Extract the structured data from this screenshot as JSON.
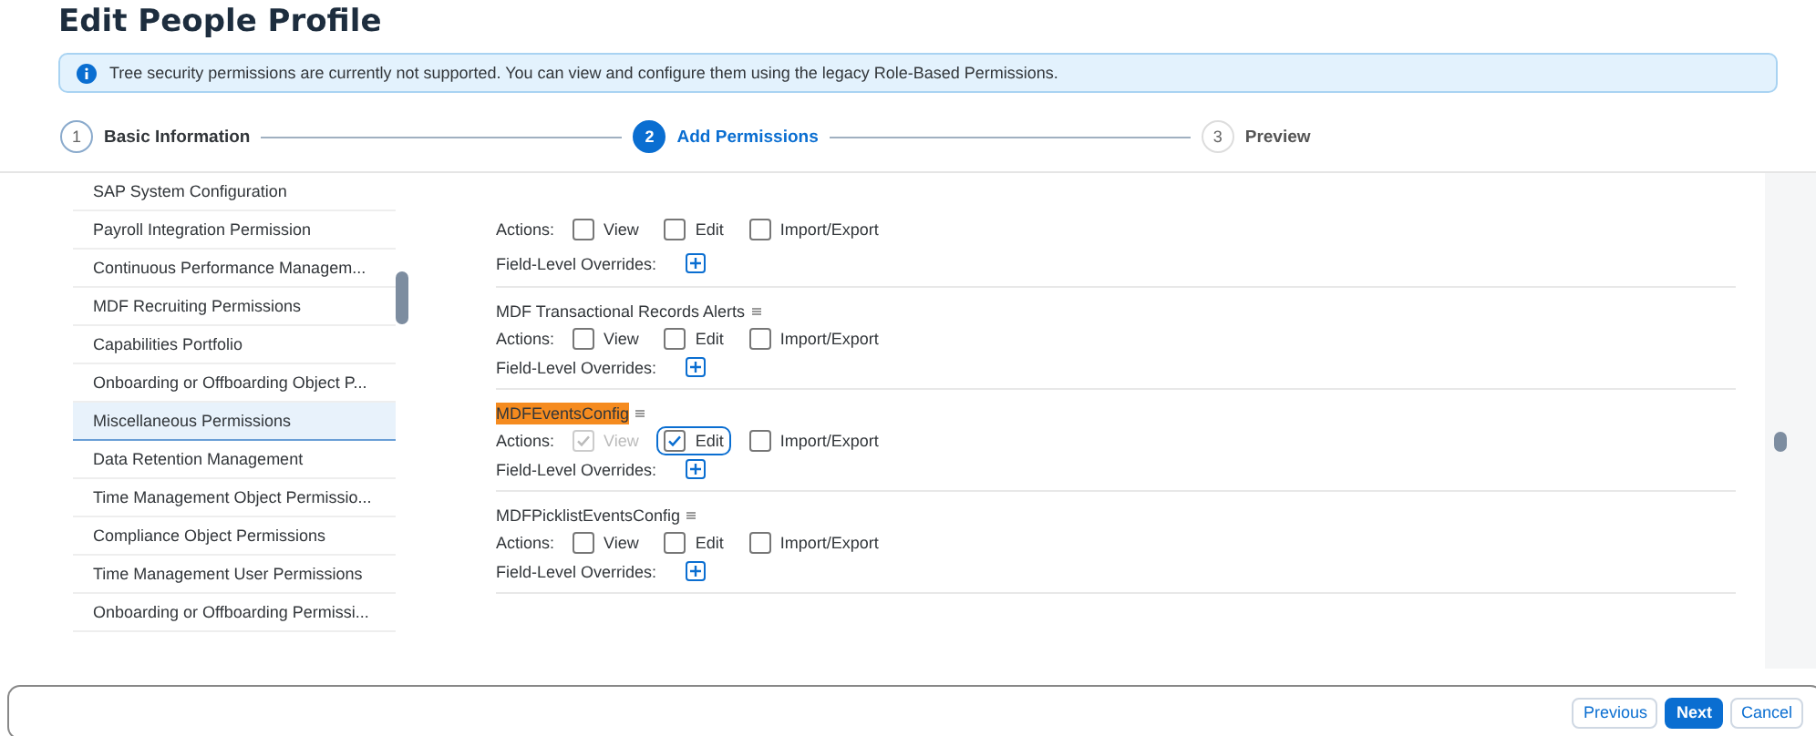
{
  "page": {
    "title": "Edit People Profile"
  },
  "info_strip": {
    "text": "Tree security permissions are currently not supported. You can view and configure them using the legacy Role-Based Permissions."
  },
  "steps": [
    {
      "number": "1",
      "label": "Basic Information",
      "selected": false,
      "completed": true
    },
    {
      "number": "2",
      "label": "Add Permissions",
      "selected": true,
      "completed": false
    },
    {
      "number": "3",
      "label": "Preview",
      "selected": false,
      "completed": false
    }
  ],
  "sidebar": {
    "items": [
      {
        "label": "SAP System Configuration",
        "selected": false
      },
      {
        "label": "Payroll Integration Permission",
        "selected": false
      },
      {
        "label": "Continuous Performance Managem...",
        "selected": false
      },
      {
        "label": "MDF Recruiting Permissions",
        "selected": false
      },
      {
        "label": "Capabilities Portfolio",
        "selected": false
      },
      {
        "label": "Onboarding or Offboarding Object P...",
        "selected": false
      },
      {
        "label": "Miscellaneous Permissions",
        "selected": true
      },
      {
        "label": "Data Retention Management",
        "selected": false
      },
      {
        "label": "Time Management Object Permissio...",
        "selected": false
      },
      {
        "label": "Compliance Object Permissions",
        "selected": false
      },
      {
        "label": "Time Management User Permissions",
        "selected": false
      },
      {
        "label": "Onboarding or Offboarding Permissi...",
        "selected": false
      }
    ]
  },
  "permissions": [
    {
      "actions_label": "Actions:",
      "overrides_label": "Field-Level Overrides:",
      "actions": [
        {
          "label": "View",
          "checked": false,
          "disabled": false,
          "focused": false
        },
        {
          "label": "Edit",
          "checked": false,
          "disabled": false,
          "focused": false
        },
        {
          "label": "Import/Export",
          "checked": false,
          "disabled": false,
          "focused": false
        }
      ]
    },
    {
      "name": "MDF Transactional Records Alerts",
      "highlighted": false,
      "actions_label": "Actions:",
      "overrides_label": "Field-Level Overrides:",
      "actions": [
        {
          "label": "View",
          "checked": false,
          "disabled": false,
          "focused": false
        },
        {
          "label": "Edit",
          "checked": false,
          "disabled": false,
          "focused": false
        },
        {
          "label": "Import/Export",
          "checked": false,
          "disabled": false,
          "focused": false
        }
      ]
    },
    {
      "name": "MDFEventsConfig",
      "highlighted": true,
      "actions_label": "Actions:",
      "overrides_label": "Field-Level Overrides:",
      "actions": [
        {
          "label": "View",
          "checked": true,
          "disabled": true,
          "focused": false
        },
        {
          "label": "Edit",
          "checked": true,
          "disabled": false,
          "focused": true
        },
        {
          "label": "Import/Export",
          "checked": false,
          "disabled": false,
          "focused": false
        }
      ]
    },
    {
      "name": "MDFPicklistEventsConfig",
      "highlighted": false,
      "actions_label": "Actions:",
      "overrides_label": "Field-Level Overrides:",
      "actions": [
        {
          "label": "View",
          "checked": false,
          "disabled": false,
          "focused": false
        },
        {
          "label": "Edit",
          "checked": false,
          "disabled": false,
          "focused": false
        },
        {
          "label": "Import/Export",
          "checked": false,
          "disabled": false,
          "focused": false
        }
      ]
    }
  ],
  "footer": {
    "buttons": [
      {
        "label": "Previous",
        "kind": "secondary"
      },
      {
        "label": "Next",
        "kind": "primary"
      },
      {
        "label": "Cancel",
        "kind": "secondary"
      }
    ]
  }
}
